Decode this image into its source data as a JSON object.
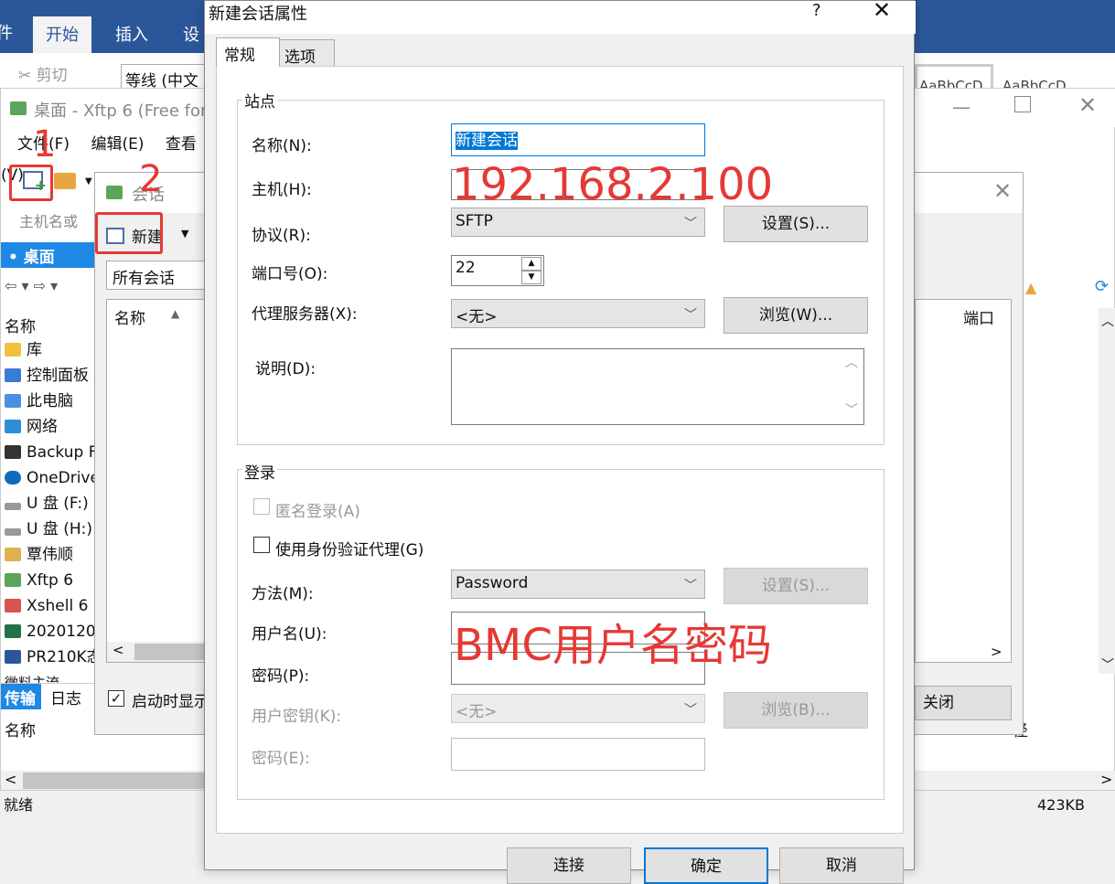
{
  "word": {
    "tabs": [
      "开始",
      "插入",
      "设"
    ],
    "clipboard_cut": "剪切",
    "font_box": "等线 (中文",
    "style_preview_1": "AaBbCcD",
    "style_preview_2": "AaBbCcD"
  },
  "xftp": {
    "title": "桌面 - Xftp 6 (Free for",
    "menu": [
      "文件(F)",
      "编辑(E)",
      "查看(V)"
    ],
    "host_placeholder": "主机名或",
    "desktop_tab": "桌面",
    "column_name": "名称",
    "column_port": "端口",
    "tree": [
      "库",
      "控制面板",
      "此电脑",
      "网络",
      "Backup F",
      "OneDrive",
      "U 盘 (F:)",
      "U 盘 (H:)",
      "覃伟顺",
      "Xftp 6",
      "Xshell 6",
      "2020120",
      "PR210K态",
      "微料主流"
    ],
    "bottom_tabs": [
      "传输",
      "日志"
    ],
    "bottom_column": "名称",
    "status_left": "就绪",
    "status_right": "423KB",
    "bottom_right_text": "径"
  },
  "session": {
    "title": "会话",
    "new_button": "新建",
    "all_sessions": "所有会话",
    "column_name": "名称",
    "show_on_start": "启动时显示",
    "close_button": "关闭"
  },
  "annotations": {
    "step1": "1",
    "step2": "2",
    "host_value": "192.168.2.100",
    "user_pass": "BMC用户名密码"
  },
  "dialog": {
    "title": "新建会话属性",
    "help": "?",
    "close": "✕",
    "tabs": [
      "常规",
      "选项"
    ],
    "site_group": "站点",
    "name_label": "名称(N):",
    "name_value": "新建会话",
    "host_label": "主机(H):",
    "protocol_label": "协议(R):",
    "protocol_value": "SFTP",
    "protocol_settings": "设置(S)...",
    "port_label": "端口号(O):",
    "port_value": "22",
    "proxy_label": "代理服务器(X):",
    "proxy_value": "<无>",
    "proxy_browse": "浏览(W)...",
    "desc_label": "说明(D):",
    "login_group": "登录",
    "anonymous": "匿名登录(A)",
    "auth_agent": "使用身份验证代理(G)",
    "method_label": "方法(M):",
    "method_value": "Password",
    "method_settings": "设置(S)...",
    "username_label": "用户名(U):",
    "password_label": "密码(P):",
    "userkey_label": "用户密钥(K):",
    "userkey_value": "<无>",
    "userkey_browse": "浏览(B)...",
    "passphrase_label": "密码(E):",
    "buttons": [
      "连接",
      "确定",
      "取消"
    ]
  }
}
